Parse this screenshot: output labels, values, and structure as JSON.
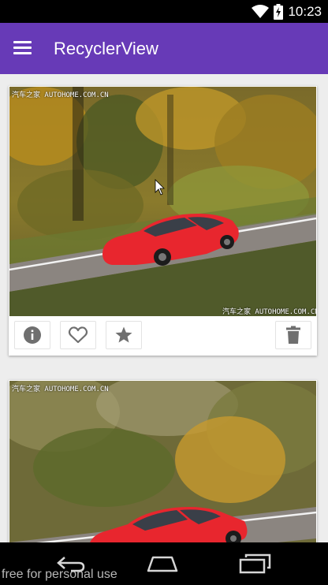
{
  "status": {
    "time": "10:23"
  },
  "appbar": {
    "title": "RecyclerView"
  },
  "cards": [
    {
      "watermark_top": "汽车之家 AUTOHOME.COM.CN",
      "watermark_bottom": "汽车之家 AUTOHOME.COM.CN",
      "actions": [
        "info-icon",
        "heart-outline-icon",
        "star-icon",
        "delete-icon"
      ]
    },
    {
      "watermark_top": "汽车之家 AUTOHOME.COM.CN"
    }
  ],
  "footer": {
    "note": "free for personal use"
  },
  "colors": {
    "primary": "#673ab7",
    "background": "#ededed",
    "icon": "#6f6f6f",
    "car": "#e8262e"
  }
}
